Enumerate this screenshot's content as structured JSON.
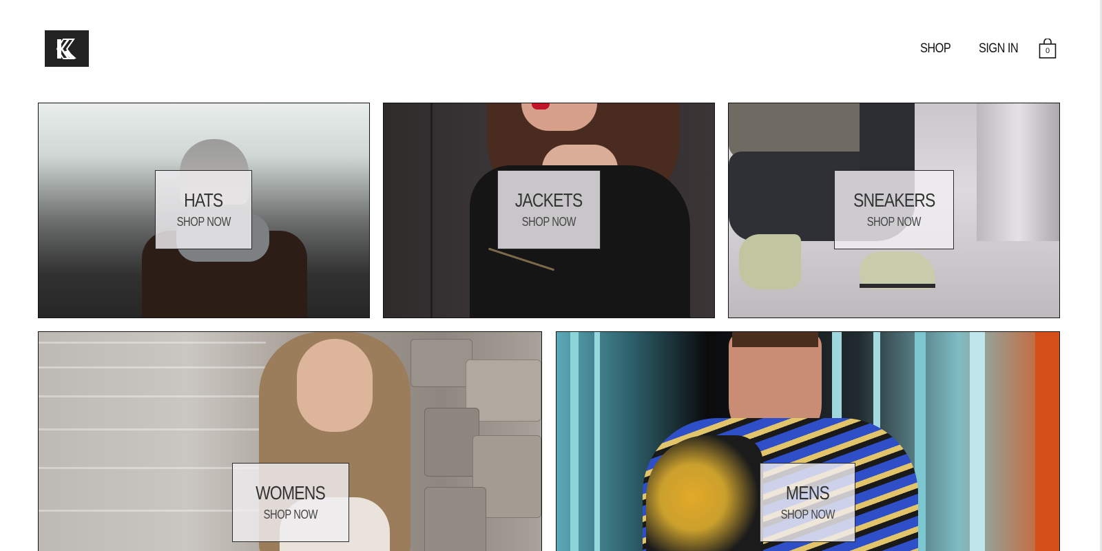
{
  "header": {
    "logo_name": "K-logo-icon",
    "nav": [
      {
        "label": "SHOP"
      },
      {
        "label": "SIGN IN"
      }
    ],
    "cart": {
      "icon": "shopping-bag-icon",
      "count": "0"
    }
  },
  "categories": [
    {
      "title": "HATS",
      "cta": "SHOP NOW"
    },
    {
      "title": "JACKETS",
      "cta": "SHOP NOW"
    },
    {
      "title": "SNEAKERS",
      "cta": "SHOP NOW"
    },
    {
      "title": "WOMENS",
      "cta": "SHOP NOW"
    },
    {
      "title": "MENS",
      "cta": "SHOP NOW"
    }
  ],
  "colors": {
    "text": "#222222",
    "logo_bg": "#222222",
    "label_bg": "#f0eef0",
    "border": "#111111"
  }
}
